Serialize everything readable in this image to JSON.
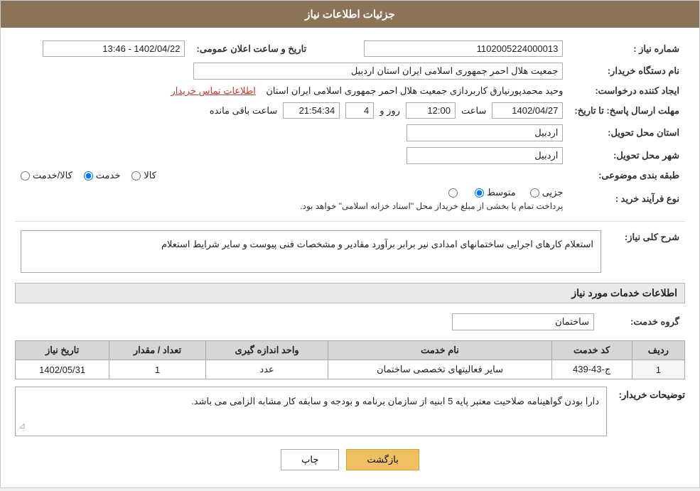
{
  "header": {
    "title": "جزئیات اطلاعات نیاز"
  },
  "fields": {
    "need_number_label": "شماره نیاز :",
    "need_number_value": "1102005224000013",
    "date_label": "تاریخ و ساعت اعلان عمومی:",
    "date_value": "1402/04/22 - 13:46",
    "buyer_org_label": "نام دستگاه خریدار:",
    "buyer_org_value": "جمعیت هلال احمر جمهوری اسلامی ایران استان اردبیل",
    "creator_label": "ایجاد کننده درخواست:",
    "creator_value": "وحید محمدپورنیارق کاربردازی جمعیت هلال احمر جمهوری اسلامی ایران استان",
    "contact_link": "اطلاعات تماس خریدار",
    "deadline_label": "مهلت ارسال پاسخ: تا تاریخ:",
    "deadline_date": "1402/04/27",
    "deadline_time_label": "ساعت",
    "deadline_time": "12:00",
    "deadline_days_label": "روز و",
    "deadline_days": "4",
    "deadline_remaining_label": "ساعت باقی مانده",
    "deadline_remaining": "21:54:34",
    "province_delivery_label": "استان محل تحویل:",
    "province_delivery_value": "اردبیل",
    "city_delivery_label": "شهر محل تحویل:",
    "city_delivery_value": "اردبیل",
    "category_label": "طبقه بندی موضوعی:",
    "category_options": [
      "کالا",
      "خدمت",
      "کالا/خدمت"
    ],
    "category_selected": "خدمت",
    "process_label": "نوع فرآیند خرید :",
    "process_options": [
      "جزیی",
      "متوسط",
      ""
    ],
    "process_selected": "متوسط",
    "process_note": "پرداخت تمام یا بخشی از مبلغ خریداز محل \"اسناد خزانه اسلامی\" خواهد بود.",
    "description_section": "شرح کلی نیاز:",
    "description_text": "استعلام کارهای اجرایی ساختمانهای امدادی نیر برابر برآورد مقادیر و مشخصات فنی پیوست و سایر شرایط استعلام",
    "service_info_section": "اطلاعات خدمات مورد نیاز",
    "service_group_label": "گروه خدمت:",
    "service_group_value": "ساختمان",
    "table_headers": [
      "ردیف",
      "کد خدمت",
      "نام خدمت",
      "واحد اندازه گیری",
      "تعداد / مقدار",
      "تاریخ نیاز"
    ],
    "table_rows": [
      {
        "row": "1",
        "code": "ج-43-439",
        "name": "سایر فعالیتهای تخصصی ساختمان",
        "unit": "عدد",
        "quantity": "1",
        "date": "1402/05/31"
      }
    ],
    "buyer_desc_label": "توضیحات خریدار:",
    "buyer_desc_text": "دارا بودن گواهینامه صلاحیت معتبر پایه 5 ابنیه از سازمان برنامه و بودجه و سابقه کار مشابه الزامی می باشد.",
    "btn_print": "چاپ",
    "btn_back": "بازگشت"
  }
}
